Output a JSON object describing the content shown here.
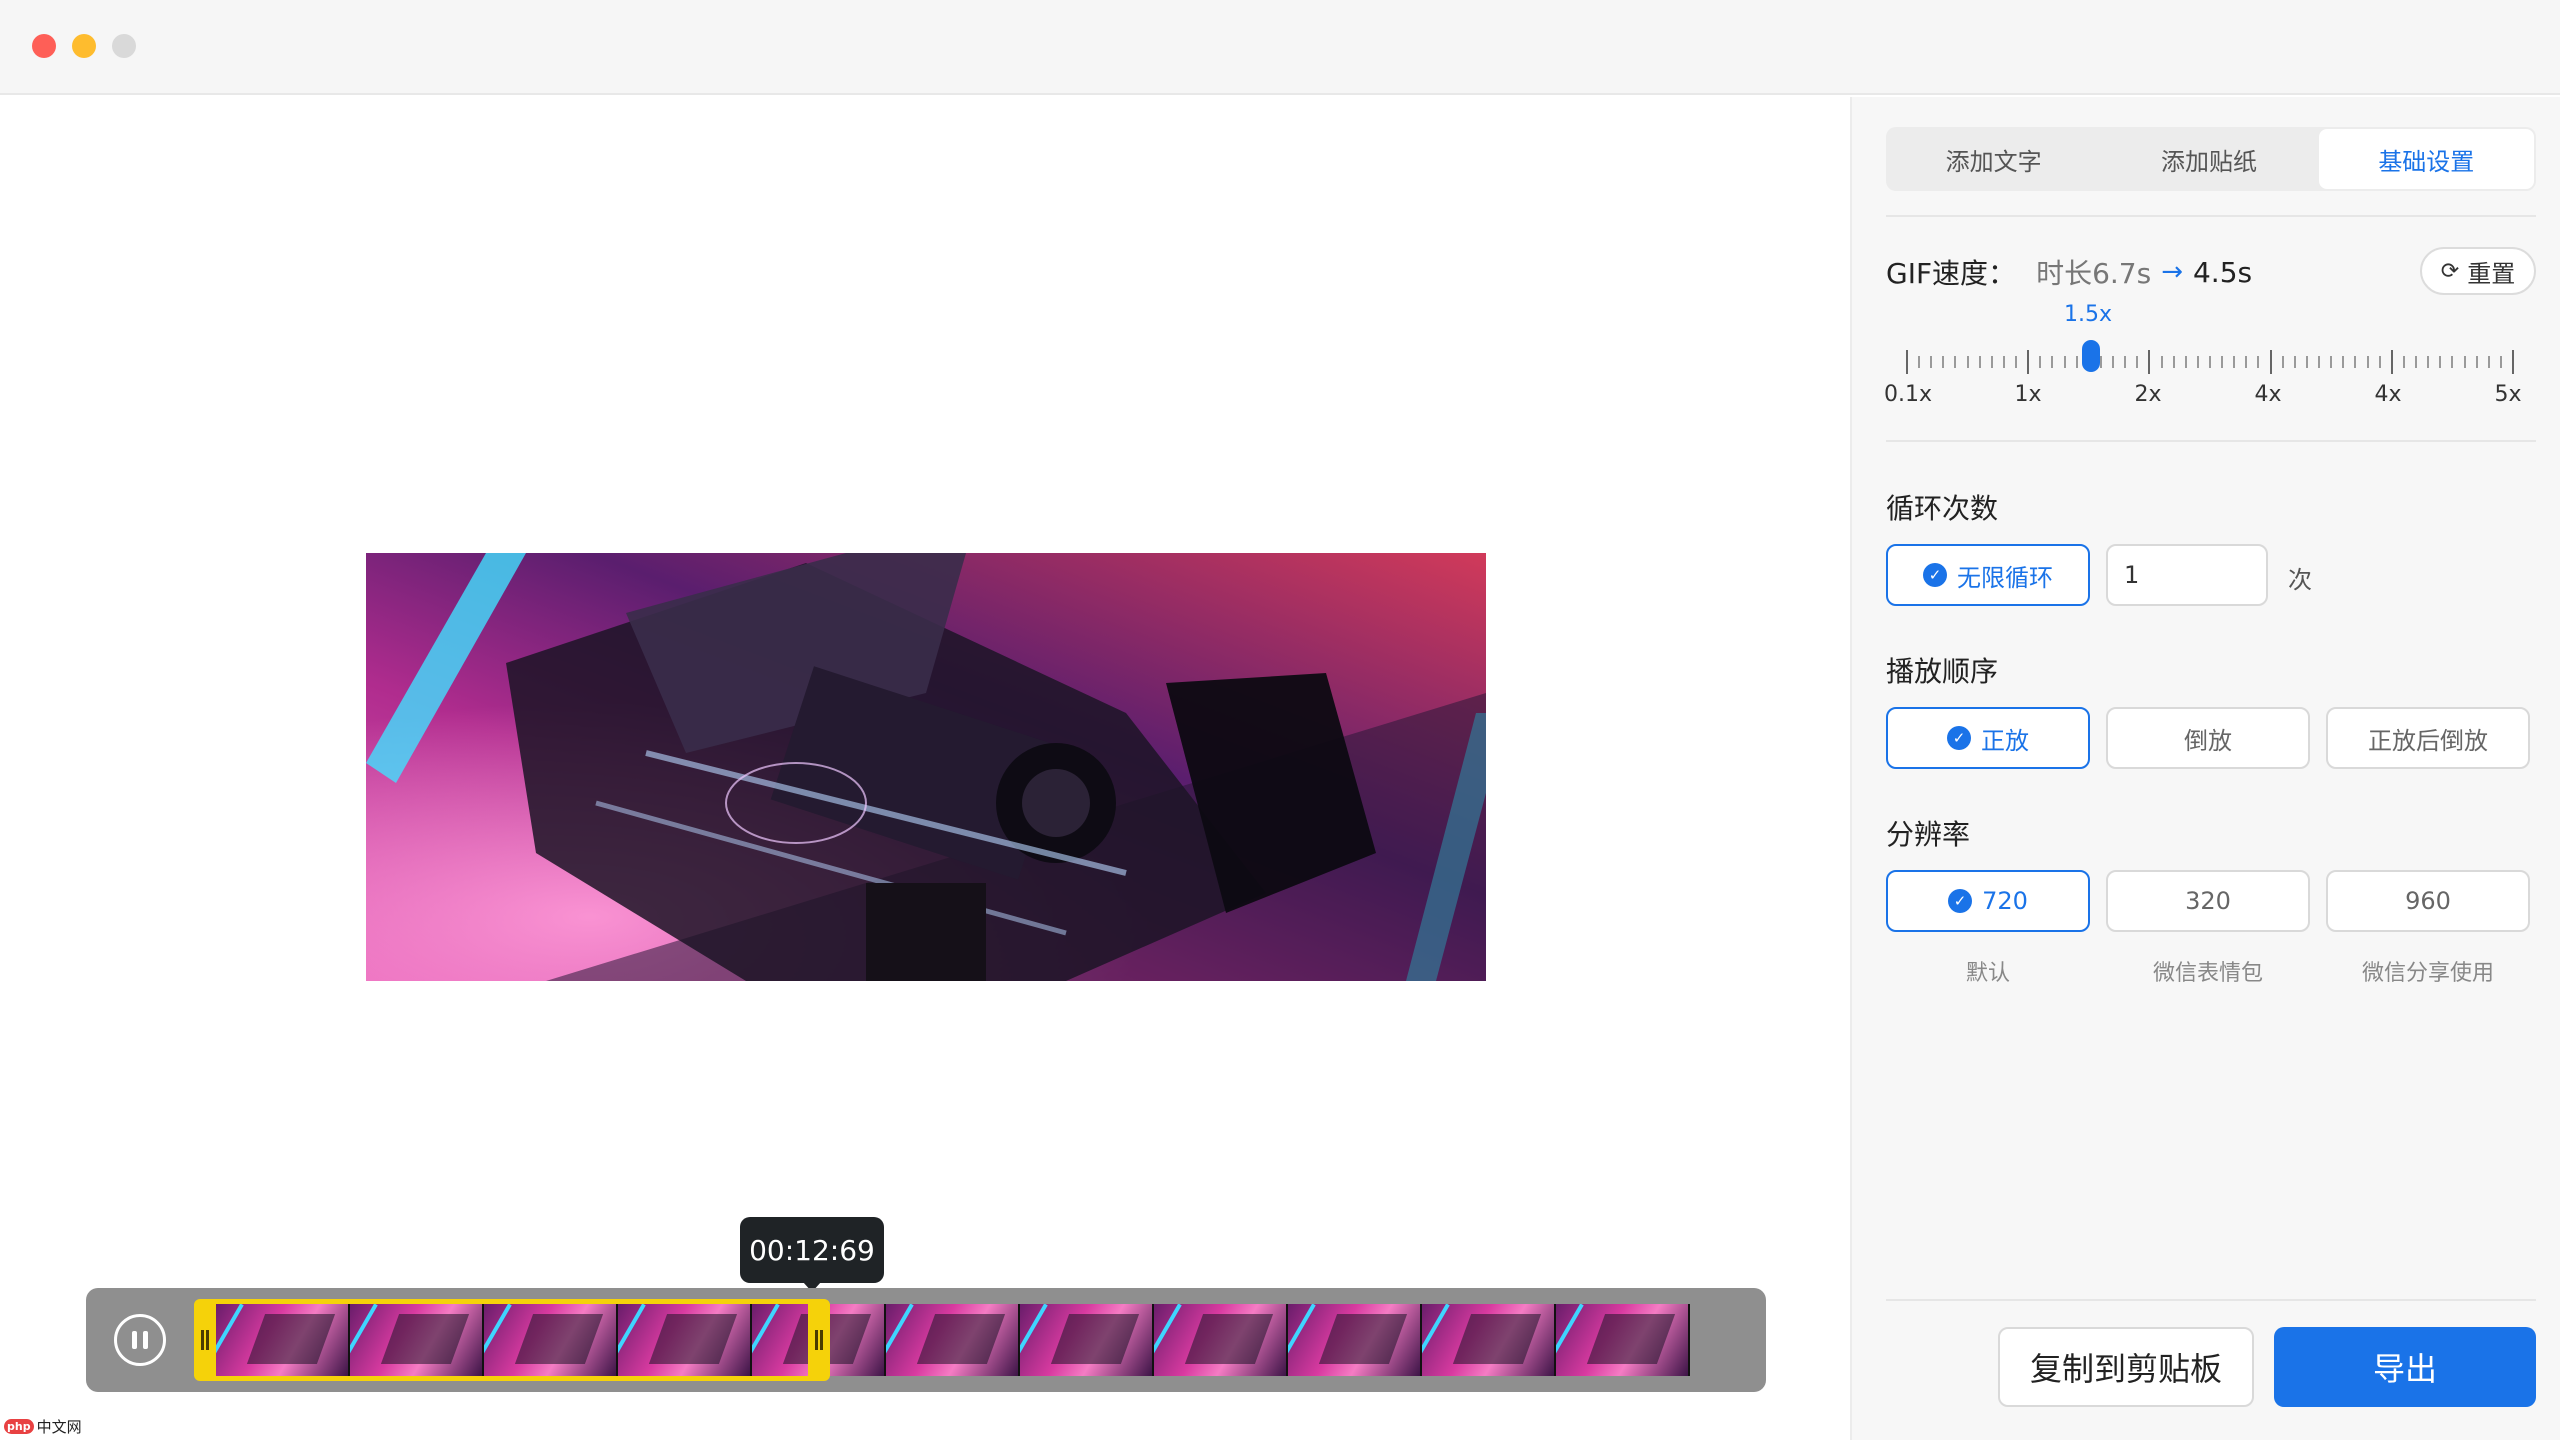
{
  "window": {
    "title": ""
  },
  "preview": {
    "image": "camera-rig-photo"
  },
  "timeline": {
    "current_time": "00:12:69",
    "frame_count": 11,
    "selection_start_fraction": 0.0,
    "selection_end_fraction": 0.41
  },
  "tabs": [
    {
      "label": "添加文字",
      "active": false
    },
    {
      "label": "添加贴纸",
      "active": false
    },
    {
      "label": "基础设置",
      "active": true
    }
  ],
  "speed": {
    "label": "GIF速度：",
    "original": "时长6.7s",
    "arrow": "→",
    "new": "4.5s",
    "reset_label": "重置",
    "current_value_label": "1.5x",
    "current_value": 1.5,
    "scale_labels": [
      "0.1x",
      "1x",
      "2x",
      "4x",
      "4x",
      "5x"
    ]
  },
  "loop": {
    "title": "循环次数",
    "infinite_label": "无限循环",
    "count_value": "1",
    "unit": "次"
  },
  "order": {
    "title": "播放顺序",
    "options": [
      "正放",
      "倒放",
      "正放后倒放"
    ],
    "selected": 0
  },
  "resolution": {
    "title": "分辨率",
    "options": [
      {
        "value": "720",
        "caption": "默认"
      },
      {
        "value": "320",
        "caption": "微信表情包"
      },
      {
        "value": "960",
        "caption": "微信分享使用"
      }
    ],
    "selected": 0
  },
  "actions": {
    "copy_label": "复制到剪贴板",
    "export_label": "导出"
  },
  "watermark": {
    "badge": "php",
    "text": "中文网"
  },
  "colors": {
    "accent": "#1a73e8",
    "selection": "#f5d20a",
    "timeline_bg": "#8f8f8f"
  }
}
